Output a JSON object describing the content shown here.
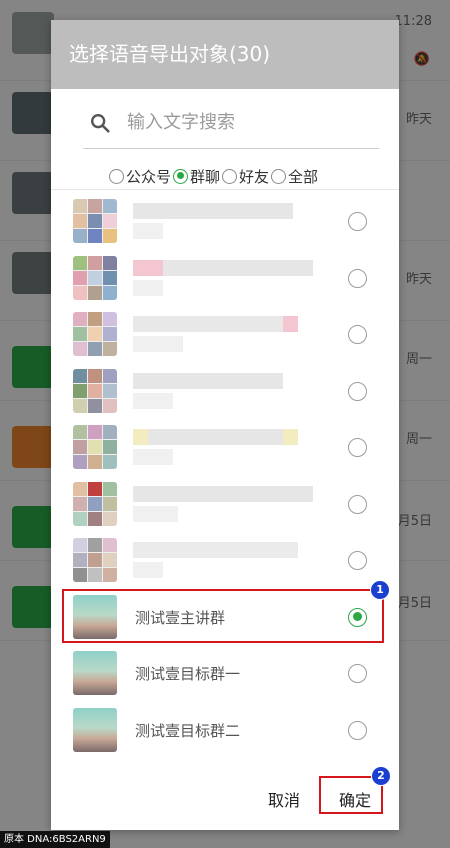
{
  "background": {
    "times": [
      "11:28",
      "昨天",
      "昨天",
      "周一",
      "周一",
      "月5日",
      "月5日"
    ]
  },
  "dialog": {
    "title": "选择语音导出对象(30)",
    "search_placeholder": "输入文字搜索",
    "filters": [
      {
        "label": "公众号",
        "selected": false
      },
      {
        "label": "群聊",
        "selected": true
      },
      {
        "label": "好友",
        "selected": false
      },
      {
        "label": "全部",
        "selected": false
      }
    ],
    "named_rows": [
      {
        "label": "测试壹主讲群",
        "selected": true
      },
      {
        "label": "测试壹目标群一",
        "selected": false
      },
      {
        "label": "测试壹目标群二",
        "selected": false
      }
    ],
    "cancel_label": "取消",
    "ok_label": "确定"
  },
  "badges": {
    "first": "1",
    "second": "2"
  },
  "watermark": "原本 DNA:6BS2ARN9",
  "colors": {
    "accent": "#2aa846",
    "highlight": "#d6161d",
    "badge": "#1a3fd1",
    "header": "#bdbdbd"
  }
}
